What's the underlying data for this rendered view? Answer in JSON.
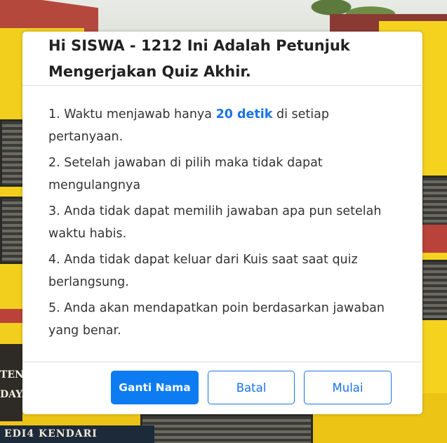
{
  "background": {
    "sign_text_line1": "TEN",
    "sign_text_line2": "DAYA",
    "bottom_sign_text": "EDI4 KENDARI"
  },
  "modal": {
    "title": "Hi SISWA - 1212 Ini Adalah Petunjuk Mengerjakan Quiz Akhir.",
    "rules": [
      {
        "before": "1. Waktu menjawab hanya ",
        "highlight": "20 detik",
        "after": " di setiap pertanyaan."
      },
      {
        "text": "2. Setelah jawaban di pilih maka tidak dapat mengulangnya"
      },
      {
        "text": "3. Anda tidak dapat memilih jawaban apa pun setelah waktu habis."
      },
      {
        "text": "4. Anda tidak dapat keluar dari Kuis saat saat quiz berlangsung."
      },
      {
        "text": "5. Anda akan mendapatkan poin berdasarkan jawaban yang benar."
      }
    ],
    "buttons": {
      "change_name": "Ganti Nama",
      "cancel": "Batal",
      "start": "Mulai"
    }
  },
  "colors": {
    "accent": "#1a73e8",
    "primary_button": "#0d7cf2"
  }
}
